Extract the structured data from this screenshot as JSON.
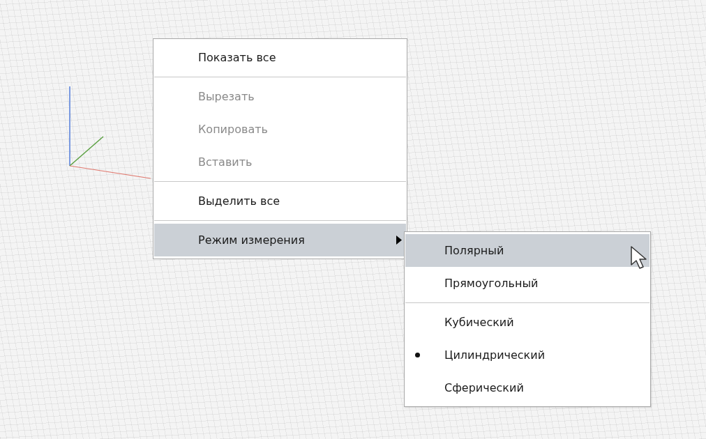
{
  "context_menu": {
    "items": [
      {
        "kind": "item",
        "label": "Показать все",
        "disabled": false,
        "selected": false
      },
      {
        "kind": "separator"
      },
      {
        "kind": "item",
        "label": "Вырезать",
        "disabled": true,
        "selected": false
      },
      {
        "kind": "item",
        "label": "Копировать",
        "disabled": true,
        "selected": false
      },
      {
        "kind": "item",
        "label": "Вставить",
        "disabled": true,
        "selected": false
      },
      {
        "kind": "separator"
      },
      {
        "kind": "item",
        "label": "Выделить все",
        "disabled": false,
        "selected": false
      },
      {
        "kind": "separator"
      },
      {
        "kind": "submenu",
        "label": "Режим измерения",
        "disabled": false,
        "selected": true,
        "expanded": true
      }
    ]
  },
  "submenu": {
    "items": [
      {
        "kind": "item",
        "label": "Полярный",
        "selected": true,
        "checked": false
      },
      {
        "kind": "item",
        "label": "Прямоугольный",
        "selected": false,
        "checked": false
      },
      {
        "kind": "separator"
      },
      {
        "kind": "item",
        "label": "Кубический",
        "selected": false,
        "checked": false
      },
      {
        "kind": "item",
        "label": "Цилиндрический",
        "selected": false,
        "checked": true
      },
      {
        "kind": "item",
        "label": "Сферический",
        "selected": false,
        "checked": false
      }
    ]
  }
}
